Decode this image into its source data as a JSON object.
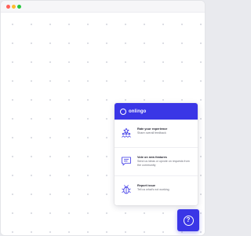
{
  "window": {
    "controls": [
      "close",
      "minimize",
      "maximize"
    ]
  },
  "widget": {
    "brand": "onlingo",
    "accent_color": "#3a36e6",
    "items": [
      {
        "icon": "star-people-icon",
        "title": "Rate your experience",
        "description": "Share overall feedback"
      },
      {
        "icon": "chat-idea-icon",
        "title": "Vote on new features",
        "description": "Send us ideas or upvote on requests from the community"
      },
      {
        "icon": "bug-icon",
        "title": "Report issue",
        "description": "Tell us what's not working"
      }
    ]
  },
  "help_button": {
    "icon": "question-icon",
    "glyph": "?"
  }
}
